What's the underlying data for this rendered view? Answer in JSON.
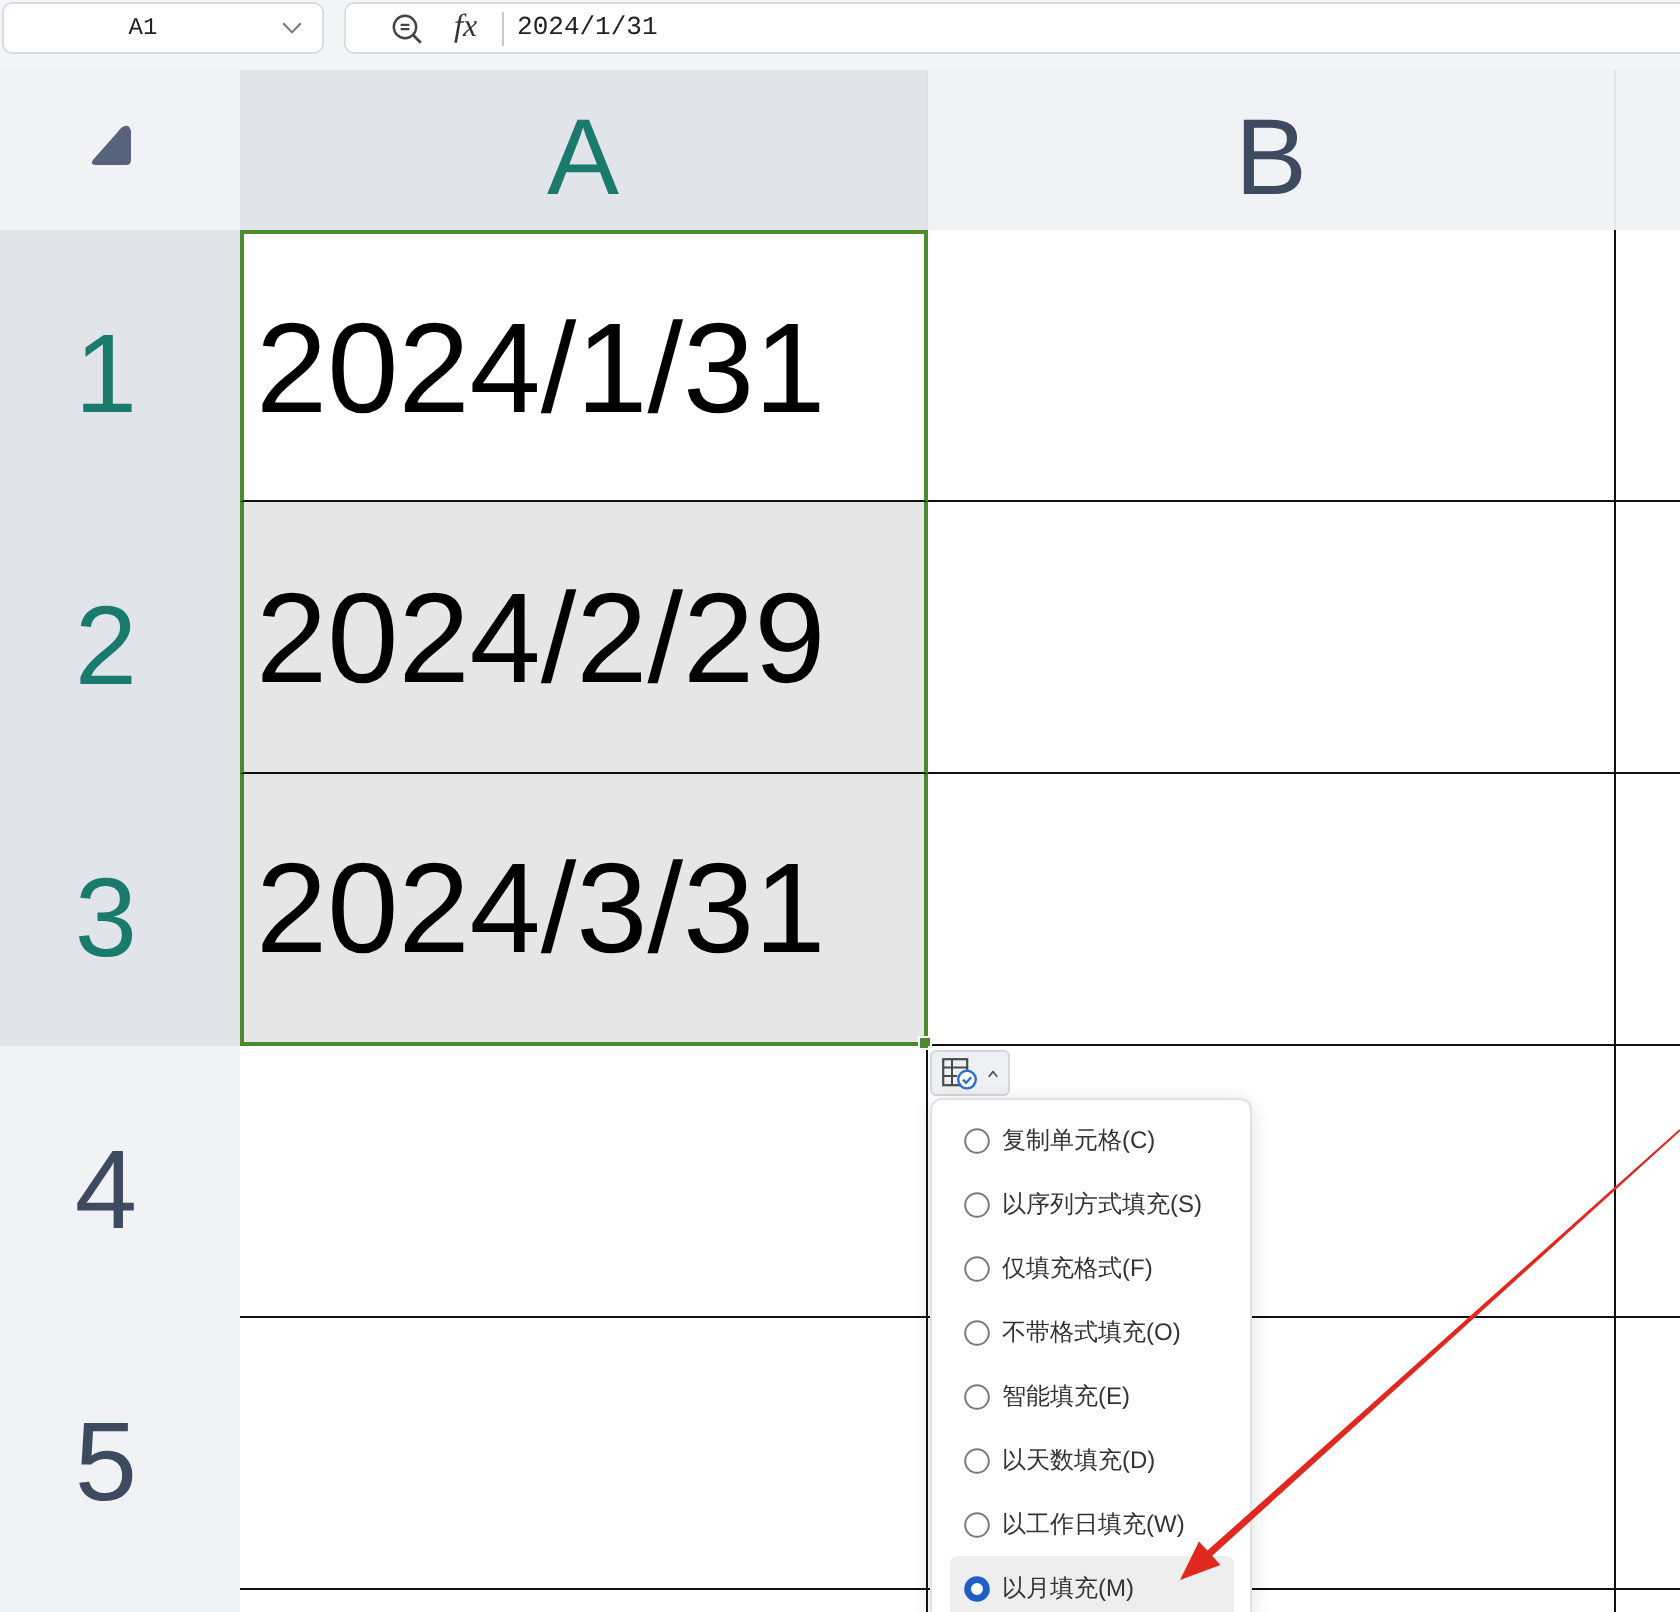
{
  "name_box": {
    "value": "A1"
  },
  "formula_bar": {
    "function_label": "fx",
    "value": "2024/1/31"
  },
  "columns": [
    {
      "label": "A",
      "selected": true
    },
    {
      "label": "B",
      "selected": false
    }
  ],
  "rows": [
    {
      "label": "1",
      "selected": true,
      "cells": [
        {
          "value": "2024/1/31",
          "selected": true,
          "active": true
        }
      ]
    },
    {
      "label": "2",
      "selected": true,
      "cells": [
        {
          "value": "2024/2/29",
          "selected": true,
          "active": false
        }
      ]
    },
    {
      "label": "3",
      "selected": true,
      "cells": [
        {
          "value": "2024/3/31",
          "selected": true,
          "active": false
        }
      ]
    },
    {
      "label": "4",
      "selected": false
    },
    {
      "label": "5",
      "selected": false
    }
  ],
  "autofill_menu": {
    "items": [
      {
        "label": "复制单元格(C)",
        "selected": false
      },
      {
        "label": "以序列方式填充(S)",
        "selected": false
      },
      {
        "label": "仅填充格式(F)",
        "selected": false
      },
      {
        "label": "不带格式填充(O)",
        "selected": false
      },
      {
        "label": "智能填充(E)",
        "selected": false
      },
      {
        "label": "以天数填充(D)",
        "selected": false
      },
      {
        "label": "以工作日填充(W)",
        "selected": false
      },
      {
        "label": "以月填充(M)",
        "selected": true
      }
    ]
  }
}
